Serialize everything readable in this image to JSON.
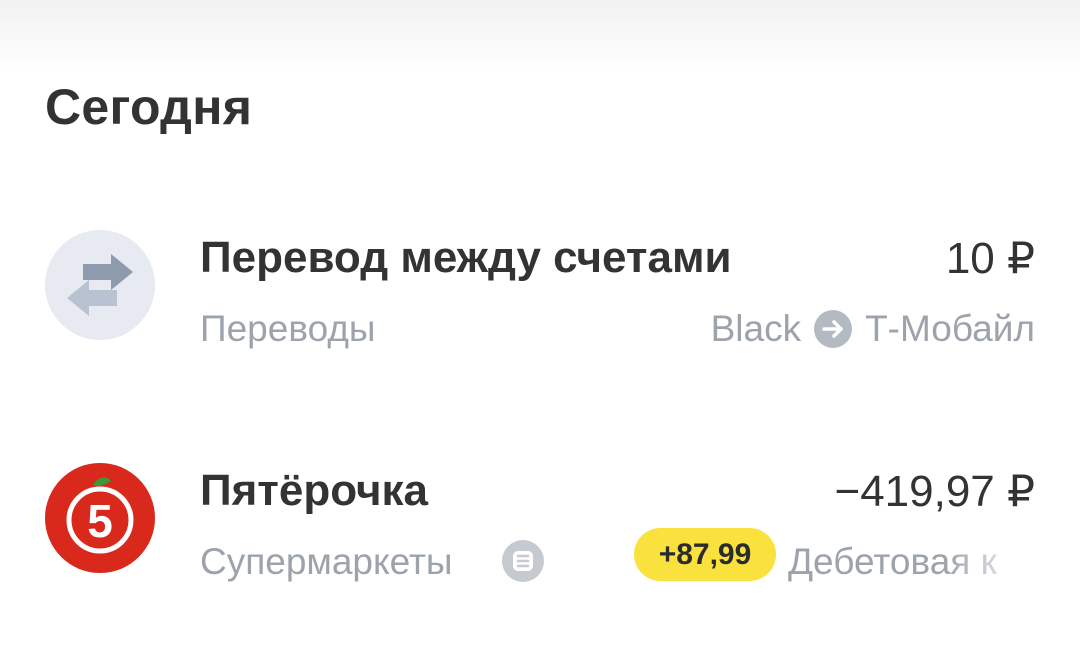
{
  "section": {
    "title": "Сегодня"
  },
  "operations": [
    {
      "name": "Перевод между счетами",
      "amount": "10 ₽",
      "category": "Переводы",
      "from_account": "Black",
      "to_account": "Т-Мобайл",
      "icon": "transfer-arrows-icon"
    },
    {
      "name": "Пятёрочка",
      "amount": "−419,97 ₽",
      "category": "Супермаркеты",
      "cashback": "+87,99",
      "account": "Дебетовая к",
      "icon": "pyaterochka-logo-icon"
    }
  ],
  "colors": {
    "title_text": "#333333",
    "secondary_text": "#9da3ab",
    "cashback_badge": "#f9e13e",
    "pyaterochka_red": "#d9281c",
    "transfer_icon_bg": "#e7ebf1"
  }
}
